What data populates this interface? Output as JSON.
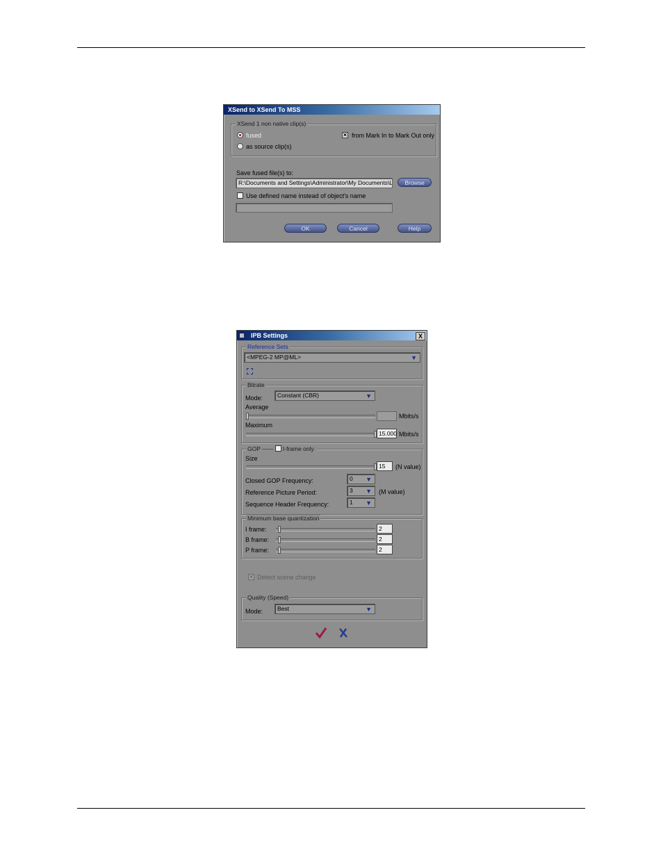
{
  "dialog1": {
    "title": "XSend to XSend To MSS",
    "group_label": "XSend 1 non native clip(s)",
    "radio_fused": "fused",
    "radio_source": "as source clip(s)",
    "check_mark": "from Mark In to Mark Out only",
    "save_label": "Save fused file(s) to:",
    "path_value": "R:\\Documents and Settings\\Administrator\\My Documents\\Liqu",
    "browse": "Browse",
    "use_defined": "Use defined name instead of object's name",
    "ok": "OK",
    "cancel": "Cancel",
    "help": "Help"
  },
  "dialog2": {
    "title": "IPB Settings",
    "close_glyph": "X",
    "ref_sets_label": "Reference Sets",
    "ref_sets_value": "<MPEG-2 MP@ML>",
    "bitrate": {
      "label": "Bitrate",
      "mode_label": "Mode:",
      "mode_value": "Constant (CBR)",
      "average_label": "Average",
      "average_value": "",
      "average_unit": "Mbits/s",
      "maximum_label": "Maximum",
      "maximum_value": "15.000",
      "maximum_unit": "Mbits/s"
    },
    "gop": {
      "label": "GOP",
      "iframe_only": "I-frame only",
      "size_label": "Size",
      "size_value": "15",
      "size_unit": "(N value)",
      "closed_label": "Closed GOP Frequency:",
      "closed_value": "0",
      "ref_period_label": "Reference Picture Period:",
      "ref_period_value": "3",
      "ref_period_unit": "(M value)",
      "seq_header_label": "Sequence Header Frequency:",
      "seq_header_value": "1"
    },
    "quant": {
      "label": "Minimum base quantization",
      "i_label": "I frame:",
      "i_value": "2",
      "b_label": "B frame:",
      "b_value": "2",
      "p_label": "P frame:",
      "p_value": "2"
    },
    "detect_scene": "Detect scene change",
    "quality": {
      "label": "Quality (Speed)",
      "mode_label": "Mode:",
      "mode_value": "Best"
    },
    "colors": {
      "ok_check": "#9a1a4a",
      "cancel_x": "#2a3a8a"
    }
  }
}
